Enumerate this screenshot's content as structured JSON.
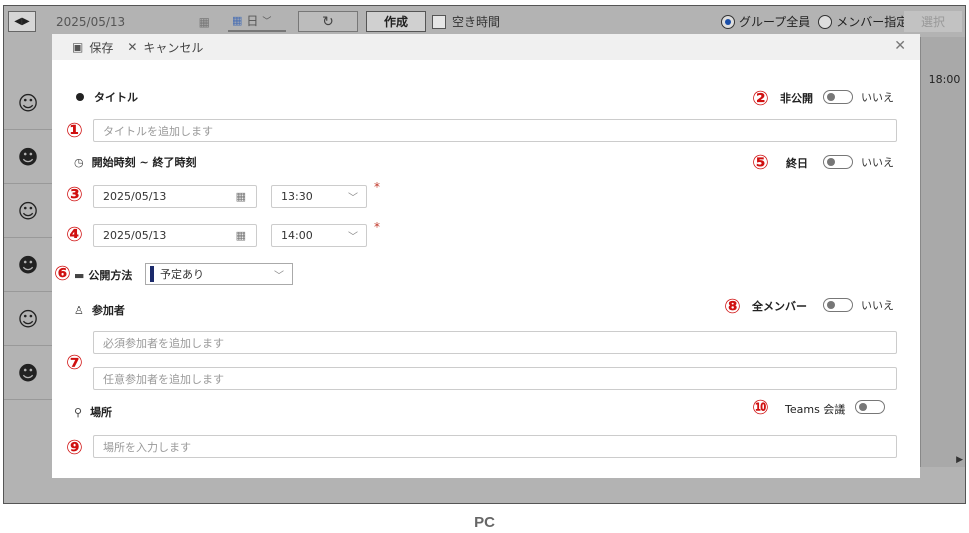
{
  "topbar": {
    "nav_arrows": "◀▶",
    "date": "2025/05/13",
    "view": "日",
    "create": "作成",
    "free_time": "空き時間",
    "group_all": "グループ全員",
    "member_select": "メンバー指定",
    "select": "選択"
  },
  "calendar": {
    "time_label": "18:00"
  },
  "modal": {
    "save": "保存",
    "cancel": "キャンセル",
    "title_label": "タイトル",
    "title_placeholder": "タイトルを追加します",
    "private_label": "非公開",
    "private_value": "いいえ",
    "time_label": "開始時刻 ~ 終了時刻",
    "allday_label": "終日",
    "allday_value": "いいえ",
    "start_date": "2025/05/13",
    "start_time": "13:30",
    "end_date": "2025/05/13",
    "end_time": "14:00",
    "publish_label": "公開方法",
    "publish_value": "予定あり",
    "attendees_label": "参加者",
    "all_members_label": "全メンバー",
    "all_members_value": "いいえ",
    "required_placeholder": "必須参加者を追加します",
    "optional_placeholder": "任意参加者を追加します",
    "location_label": "場所",
    "teams_label": "Teams 会議",
    "location_placeholder": "場所を入力します"
  },
  "annotations": [
    "①",
    "②",
    "③",
    "④",
    "⑤",
    "⑥",
    "⑦",
    "⑧",
    "⑨",
    "⑩"
  ],
  "caption": "PC"
}
